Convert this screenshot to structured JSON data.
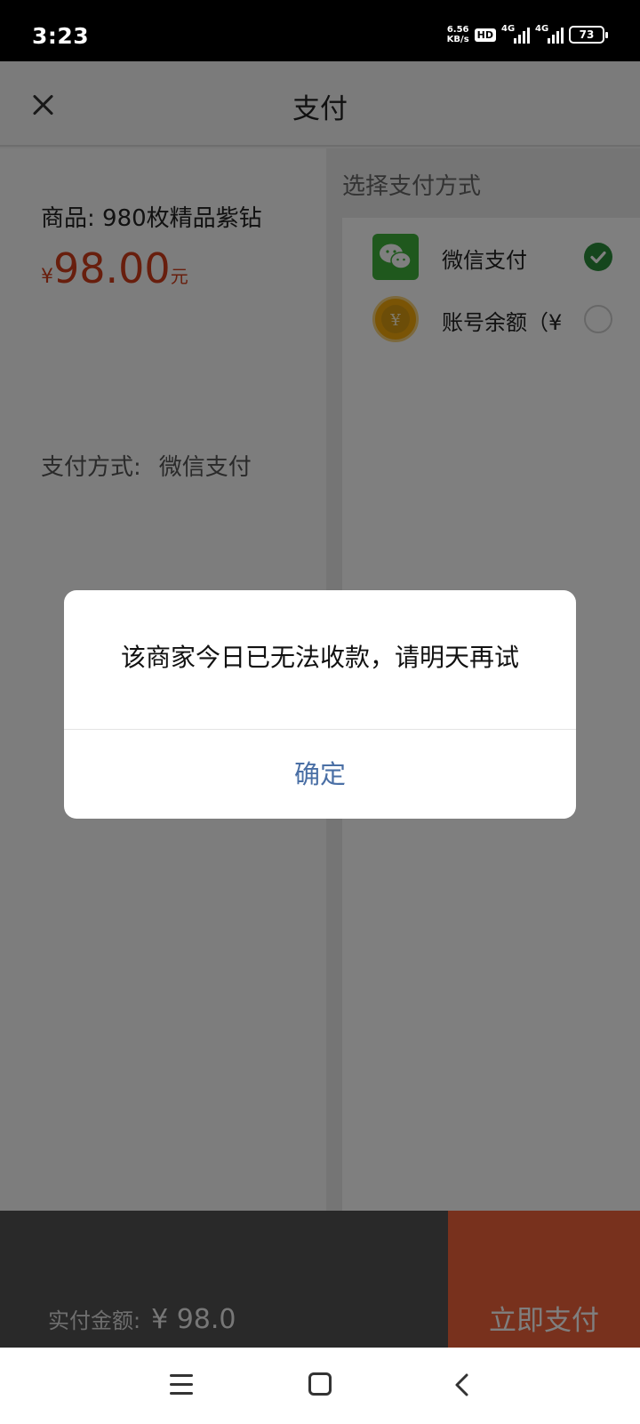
{
  "status_bar": {
    "time": "3:23",
    "net_speed_value": "6.56",
    "net_speed_unit": "KB/s",
    "hd_badge": "HD",
    "signal_1_label": "4G",
    "signal_2_label": "4G",
    "battery": "73"
  },
  "nav": {
    "title": "支付"
  },
  "order": {
    "product_label": "商品: 980枚精品紫钻",
    "price_symbol": "¥",
    "price_value": "98.00",
    "price_unit": "元",
    "pay_method_label": "支付方式:",
    "pay_method_value": "微信支付"
  },
  "methods": {
    "title": "选择支付方式",
    "items": [
      {
        "label": "微信支付",
        "selected": true,
        "icon": "wechat-icon"
      },
      {
        "label": "账号余额（¥",
        "selected": false,
        "icon": "coin-icon"
      }
    ]
  },
  "footer": {
    "total_label": "实付金额:",
    "total_value": "¥ 98.0",
    "pay_button": "立即支付"
  },
  "dialog": {
    "message": "该商家今日已无法收款，请明天再试",
    "confirm": "确定"
  },
  "colors": {
    "price": "#d13c1a",
    "pay_button": "#f0623a",
    "wechat_green": "#3fb13b",
    "check_green": "#2a8c3a",
    "dialog_button": "#4a6fa5"
  }
}
